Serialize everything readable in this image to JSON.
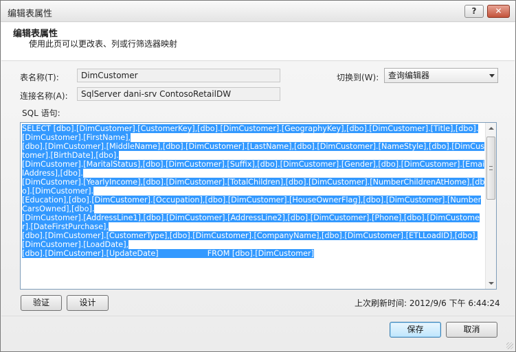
{
  "window": {
    "title": "编辑表属性",
    "help_label": "?",
    "close_label": "✕"
  },
  "header": {
    "title": "编辑表属性",
    "subtitle": "使用此页可以更改表、列或行筛选器映射"
  },
  "form": {
    "table_name_label": "表名称(T):",
    "table_name_value": "DimCustomer",
    "connection_label": "连接名称(A):",
    "connection_value": "SqlServer dani-srv ContosoRetailDW",
    "switch_label": "切换到(W):",
    "switch_value": "查询编辑器",
    "sql_label": "SQL 语句:"
  },
  "sql": {
    "lines": [
      "SELECT [dbo].[DimCustomer].[CustomerKey],[dbo].[DimCustomer].[GeographyKey],[dbo].[DimCustomer].[Title],[dbo].[DimCustomer].[FirstName],",
      "[dbo].[DimCustomer].[MiddleName],[dbo].[DimCustomer].[LastName],[dbo].[DimCustomer].[NameStyle],[dbo].[DimCustomer].[BirthDate],[dbo].",
      "[DimCustomer].[MaritalStatus],[dbo].[DimCustomer].[Suffix],[dbo].[DimCustomer].[Gender],[dbo].[DimCustomer].[EmailAddress],[dbo].",
      "[DimCustomer].[YearlyIncome],[dbo].[DimCustomer].[TotalChildren],[dbo].[DimCustomer].[NumberChildrenAtHome],[dbo].[DimCustomer].",
      "[Education],[dbo].[DimCustomer].[Occupation],[dbo].[DimCustomer].[HouseOwnerFlag],[dbo].[DimCustomer].[NumberCarsOwned],[dbo].",
      "[DimCustomer].[AddressLine1],[dbo].[DimCustomer].[AddressLine2],[dbo].[DimCustomer].[Phone],[dbo].[DimCustomer].[DateFirstPurchase],",
      "[dbo].[DimCustomer].[CustomerType],[dbo].[DimCustomer].[CompanyName],[dbo].[DimCustomer].[ETLLoadID],[dbo].[DimCustomer].[LoadDate],",
      "[dbo].[DimCustomer].[UpdateDate]                    FROM [dbo].[DimCustomer]"
    ]
  },
  "buttons": {
    "validate": "验证",
    "design": "设计",
    "save": "保存",
    "cancel": "取消"
  },
  "status": {
    "last_refresh": "上次刷新时间: 2012/9/6 下午 6:44:24"
  }
}
